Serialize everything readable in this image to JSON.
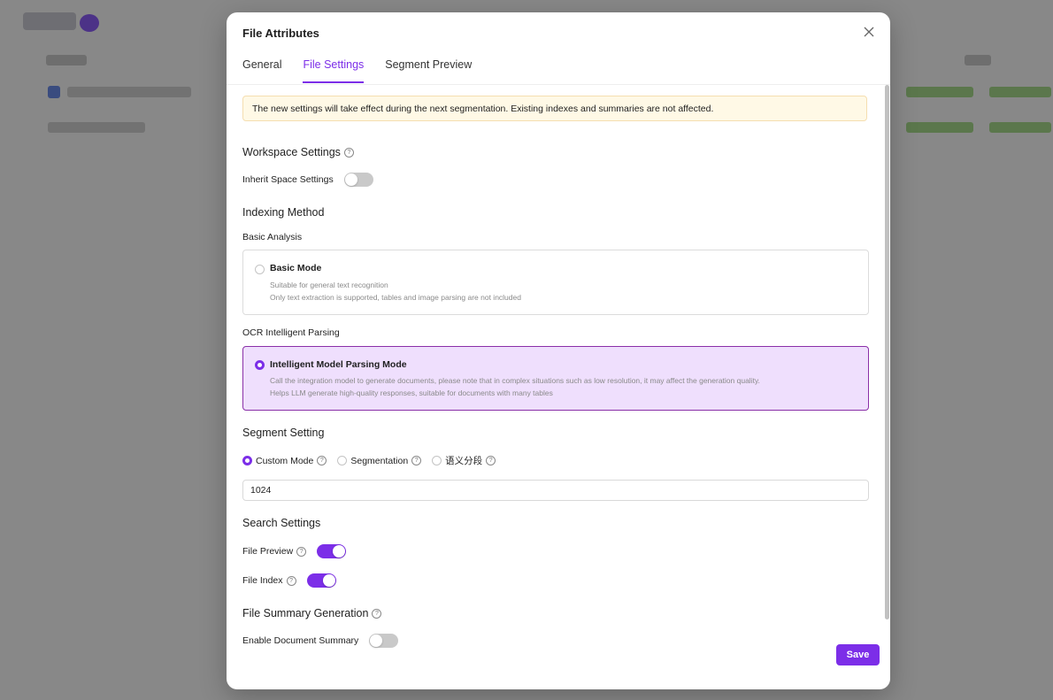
{
  "modal": {
    "title": "File Attributes",
    "tabs": [
      {
        "label": "General"
      },
      {
        "label": "File Settings"
      },
      {
        "label": "Segment Preview"
      }
    ],
    "notice": "The new settings will take effect during the next segmentation. Existing indexes and summaries are not affected.",
    "workspace": {
      "title": "Workspace Settings",
      "inherit_label": "Inherit Space Settings",
      "inherit_on": false
    },
    "indexing": {
      "title": "Indexing Method",
      "basic_group": "Basic Analysis",
      "basic_mode": {
        "name": "Basic Mode",
        "desc1": "Suitable for general text recognition",
        "desc2": "Only text extraction is supported, tables and image parsing are not included"
      },
      "ocr_group": "OCR Intelligent Parsing",
      "ocr_mode": {
        "name": "Intelligent Model Parsing Mode",
        "desc1": "Call the integration model to generate documents, please note that in complex situations such as low resolution, it may affect the generation quality.",
        "desc2": "Helps LLM generate high-quality responses, suitable for documents with many tables"
      },
      "selected": "ocr"
    },
    "segment": {
      "title": "Segment Setting",
      "options": [
        {
          "label": "Custom Mode"
        },
        {
          "label": "Segmentation"
        },
        {
          "label": "语义分段"
        }
      ],
      "selected": 0,
      "value": "1024"
    },
    "search": {
      "title": "Search Settings",
      "file_preview_label": "File Preview",
      "file_preview_on": true,
      "file_index_label": "File Index",
      "file_index_on": true
    },
    "summary": {
      "title": "File Summary Generation",
      "enable_label": "Enable Document Summary",
      "enable_on": false
    },
    "save_label": "Save",
    "accent_color": "#7c2ee8"
  }
}
